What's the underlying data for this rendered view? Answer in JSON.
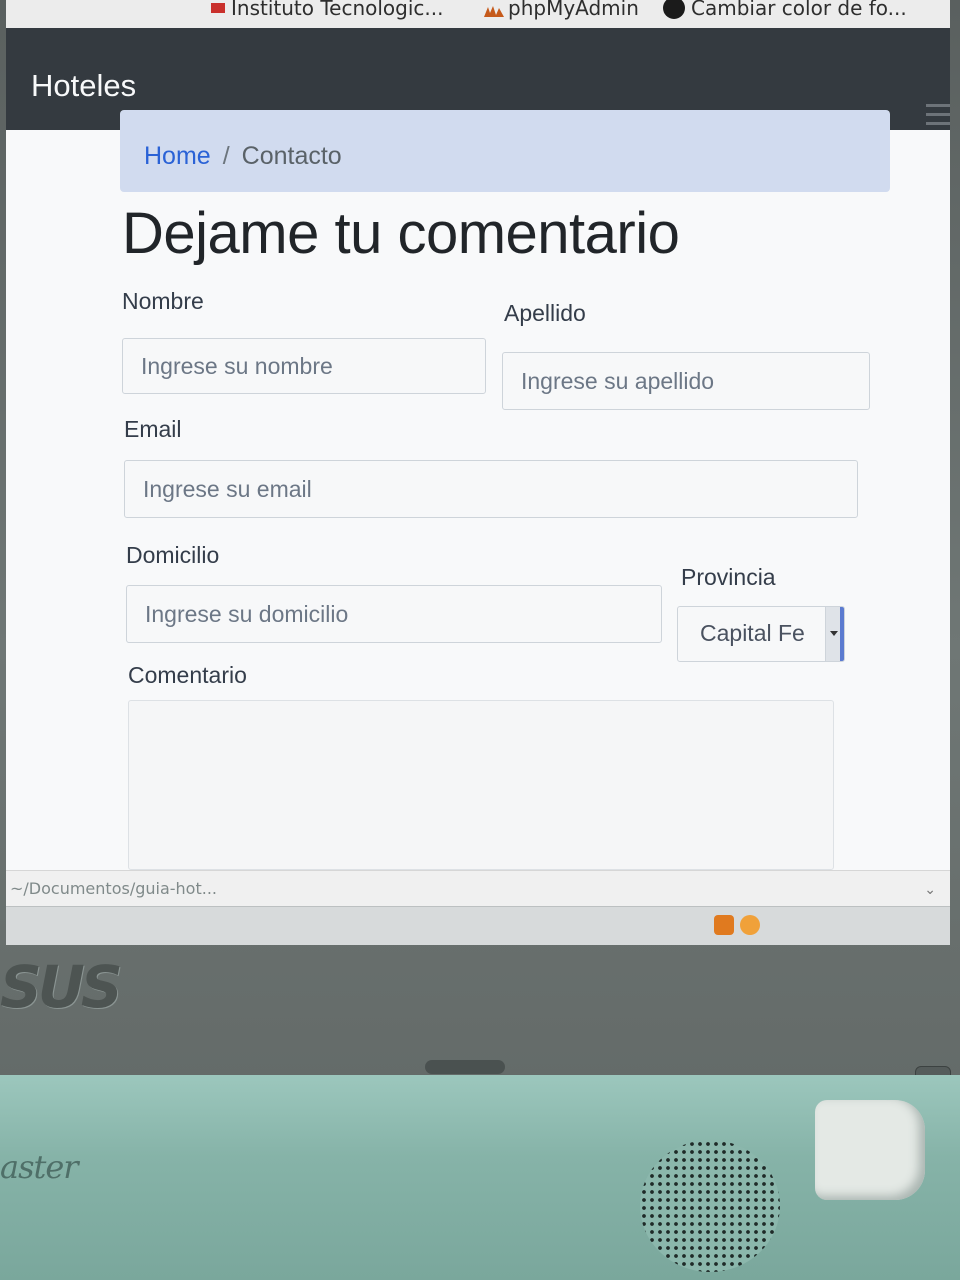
{
  "browser": {
    "tabs": [
      {
        "label": "Instituto Tecnologic..."
      },
      {
        "label": "phpMyAdmin"
      },
      {
        "label": "Cambiar color de fo..."
      }
    ],
    "status_url": "~/Documentos/guia-hot..."
  },
  "navbar": {
    "brand": "Hoteles"
  },
  "breadcrumb": {
    "home": "Home",
    "separator": "/",
    "current": "Contacto"
  },
  "form": {
    "title": "Dejame tu comentario",
    "nombre": {
      "label": "Nombre",
      "placeholder": "Ingrese su nombre"
    },
    "apellido": {
      "label": "Apellido",
      "placeholder": "Ingrese su apellido"
    },
    "email": {
      "label": "Email",
      "placeholder": "Ingrese su email"
    },
    "domicilio": {
      "label": "Domicilio",
      "placeholder": "Ingrese su domicilio"
    },
    "provincia": {
      "label": "Provincia",
      "selected": "Capital Fe"
    },
    "comentario": {
      "label": "Comentario"
    }
  },
  "hardware": {
    "bezel_brand": "SUS",
    "deck_brand": "aster"
  },
  "colors": {
    "navbar": "#343a40",
    "breadcrumb_bg": "#d1dbef",
    "link": "#2a62d6",
    "deck": "#8bb7ac"
  }
}
